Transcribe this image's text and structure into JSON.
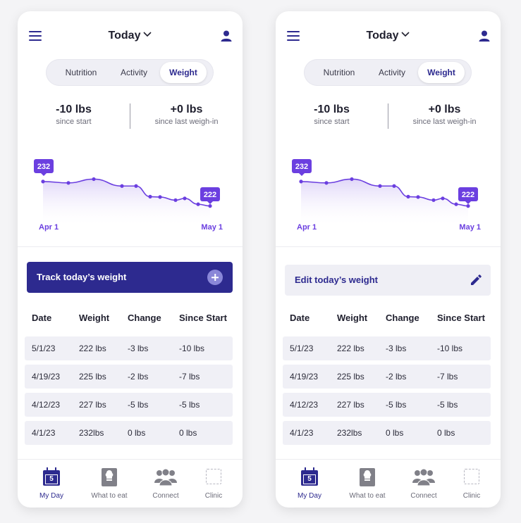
{
  "screens": [
    {
      "header": {
        "title": "Today"
      },
      "tabs": [
        {
          "label": "Nutrition"
        },
        {
          "label": "Activity"
        },
        {
          "label": "Weight"
        }
      ],
      "stats": [
        {
          "value": "-10 lbs",
          "label": "since start"
        },
        {
          "value": "+0 lbs",
          "label": "since last weigh-in"
        }
      ],
      "chart": {
        "start_label": "232",
        "end_label": "222",
        "x_start": "Apr 1",
        "x_end": "May 1"
      },
      "action": {
        "label": "Track today’s weight",
        "icon": "plus-icon"
      },
      "table": {
        "headers": [
          "Date",
          "Weight",
          "Change",
          "Since Start"
        ],
        "rows": [
          [
            "5/1/23",
            "222 lbs",
            "-3 lbs",
            "-10 lbs"
          ],
          [
            "4/19/23",
            "225 lbs",
            "-2 lbs",
            "-7 lbs"
          ],
          [
            "4/12/23",
            "227 lbs",
            "-5 lbs",
            "-5 lbs"
          ],
          [
            "4/1/23",
            "232lbs",
            "0 lbs",
            "0 lbs"
          ]
        ]
      },
      "nav": [
        {
          "label": "My Day",
          "badge": "5"
        },
        {
          "label": "What to eat"
        },
        {
          "label": "Connect"
        },
        {
          "label": "Clinic"
        }
      ]
    },
    {
      "header": {
        "title": "Today"
      },
      "tabs": [
        {
          "label": "Nutrition"
        },
        {
          "label": "Activity"
        },
        {
          "label": "Weight"
        }
      ],
      "stats": [
        {
          "value": "-10 lbs",
          "label": "since start"
        },
        {
          "value": "+0 lbs",
          "label": "since last weigh-in"
        }
      ],
      "chart": {
        "start_label": "232",
        "end_label": "222",
        "x_start": "Apr 1",
        "x_end": "May 1"
      },
      "action": {
        "label": "Edit today’s weight",
        "icon": "pencil-icon"
      },
      "table": {
        "headers": [
          "Date",
          "Weight",
          "Change",
          "Since Start"
        ],
        "rows": [
          [
            "5/1/23",
            "222 lbs",
            "-3 lbs",
            "-10 lbs"
          ],
          [
            "4/19/23",
            "225 lbs",
            "-2 lbs",
            "-7 lbs"
          ],
          [
            "4/12/23",
            "227 lbs",
            "-5 lbs",
            "-5 lbs"
          ],
          [
            "4/1/23",
            "232lbs",
            "0 lbs",
            "0 lbs"
          ]
        ]
      },
      "nav": [
        {
          "label": "My Day",
          "badge": "5"
        },
        {
          "label": "What to eat"
        },
        {
          "label": "Connect"
        },
        {
          "label": "Clinic"
        }
      ]
    }
  ],
  "chart_data": {
    "type": "line",
    "x_labels": [
      "Apr 1",
      "May 1"
    ],
    "values": [
      232,
      231.6,
      232.7,
      230.7,
      230.7,
      227.6,
      227.5,
      226.6,
      227.1,
      225.4,
      224.9
    ],
    "labeled_points": [
      {
        "label": "232",
        "value": 232
      },
      {
        "label": "222",
        "value": 222
      }
    ],
    "ylim": [
      220,
      234
    ]
  },
  "colors": {
    "primary": "#2d2a8f",
    "accent": "#6b3fe0",
    "row_bg": "#f0f0f6"
  }
}
